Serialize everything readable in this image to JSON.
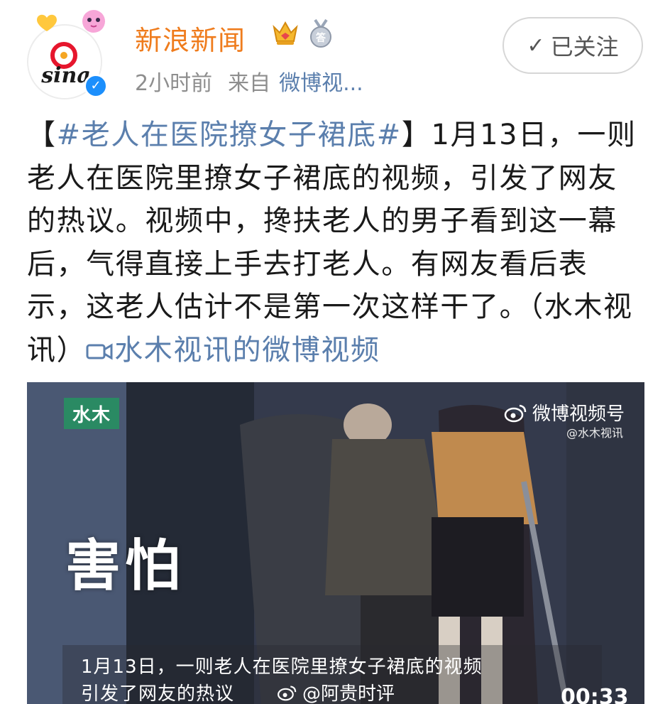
{
  "header": {
    "user_name": "新浪新闻",
    "time": "2小时前",
    "source_prefix": "来自",
    "source": "微博视...",
    "follow_label": "已关注",
    "avatar_logo_text": "sina"
  },
  "post": {
    "bracket_open": "【",
    "hashtag": "#老人在医院撩女子裙底#",
    "bracket_close": "】",
    "body": "1月13日，一则老人在医院里撩女子裙底的视频，引发了网友的热议。视频中，搀扶老人的男子看到这一幕后，气得直接上手去打老人。有网友看后表示，这老人估计不是第一次这样干了。（水木视讯）",
    "video_link": "水木视讯的微博视频"
  },
  "video": {
    "logo": "水木",
    "platform": "微博视频号",
    "handle": "@水木视讯",
    "overlay_word": "害怕",
    "subtitle_line1": "1月13日，一则老人在医院里撩女子裙底的视频",
    "subtitle_line2": "引发了网友的热议",
    "watermark": "@阿贵时评",
    "duration": "00:33"
  },
  "colors": {
    "name_orange": "#ef7c1d",
    "link_blue": "#5b7fad",
    "meta_gray": "#8e8e8e",
    "verified_blue": "#1c8ffc",
    "logo_green": "#2a8a63"
  },
  "icons": [
    "heart-sticker-icon",
    "crown-badge-icon",
    "medal-badge-icon",
    "verified-icon",
    "check-icon",
    "video-camera-icon",
    "weibo-logo-icon"
  ]
}
